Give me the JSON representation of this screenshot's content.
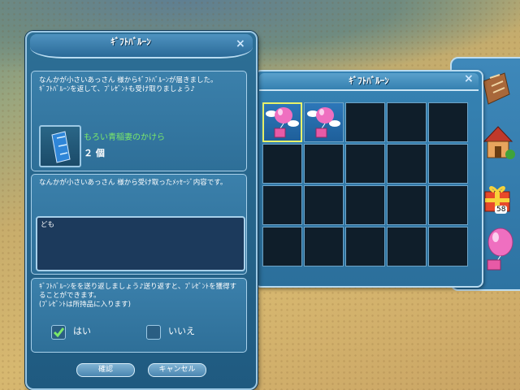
{
  "gift_dialog": {
    "title": "ｷﾞﾌﾄﾊﾞﾙｰﾝ",
    "close": "×",
    "notice_text": "なんかが小さいあっさん 様からｷﾞﾌﾄﾊﾞﾙｰﾝが届きました。\nｷﾞﾌﾄﾊﾞﾙｰﾝを返して、ﾌﾟﾚｾﾞﾝﾄも受け取りましょう♪",
    "item_name": "もろい青稲妻のかけら",
    "item_count": "２ 個",
    "message_label": "なんかが小さいあっさん 様から受け取ったﾒｯｾｰｼﾞ内容です。",
    "message_value": "ども",
    "return_text": "ｷﾞﾌﾄﾊﾞﾙｰﾝをを送り返しましょう♪送り返すと、ﾌﾟﾚｾﾞﾝﾄを獲得することができます。\n(ﾌﾟﾚｾﾞﾝﾄは所持品に入ります)",
    "yes_label": "はい",
    "no_label": "いいえ",
    "yes_checked": true,
    "confirm_label": "確認",
    "cancel_label": "キャンセル"
  },
  "inventory_window": {
    "title": "ｷﾞﾌﾄﾊﾞﾙｰﾝ",
    "close": "×",
    "slots": [
      "balloon-gift",
      "balloon-gift",
      "empty",
      "empty",
      "empty",
      "empty",
      "empty",
      "empty",
      "empty",
      "empty",
      "empty",
      "empty",
      "empty",
      "empty",
      "empty",
      "empty",
      "empty",
      "empty",
      "empty",
      "empty"
    ]
  },
  "side_menu": {
    "items": [
      "scroll-icon",
      "house-icon",
      "gift-box-icon",
      "balloon-icon"
    ],
    "gift_count": "58"
  }
}
